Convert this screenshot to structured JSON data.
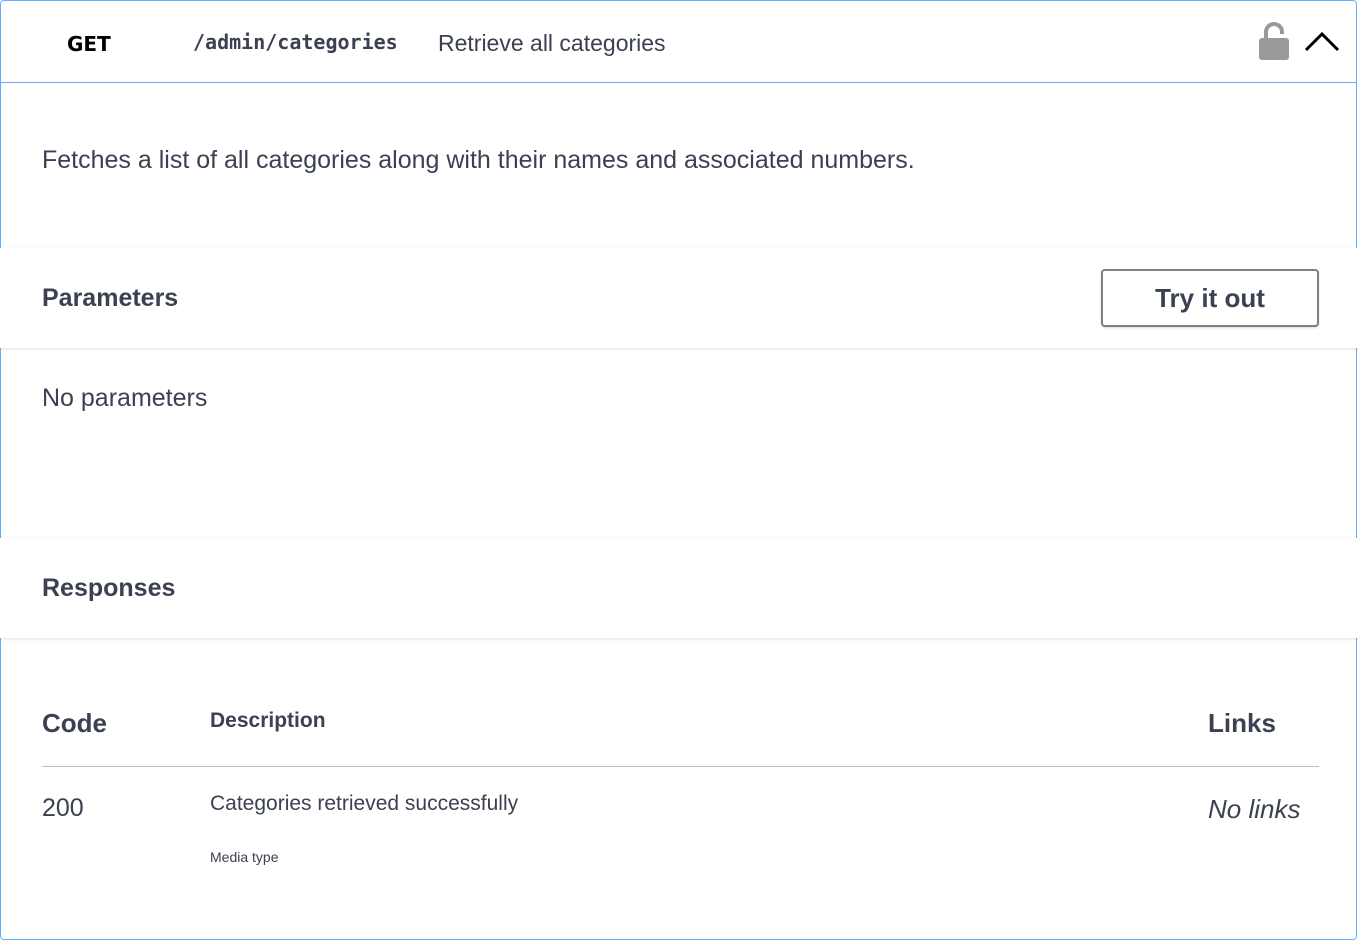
{
  "operation": {
    "method": "GET",
    "path": "/admin/categories",
    "summary": "Retrieve all categories",
    "description": "Fetches a list of all categories along with their names and associated numbers."
  },
  "icons": {
    "lock": "lock-open-icon",
    "collapse": "chevron-up-icon"
  },
  "parameters": {
    "title": "Parameters",
    "try_label": "Try it out",
    "empty_text": "No parameters"
  },
  "responses": {
    "title": "Responses",
    "columns": [
      "Code",
      "Description",
      "Links"
    ],
    "rows": [
      {
        "code": "200",
        "description": "Categories retrieved successfully",
        "media_type_label": "Media type",
        "links": "No links"
      }
    ]
  },
  "colors": {
    "accent": "#61affe",
    "text": "#3b4151",
    "icon": "#999999"
  }
}
